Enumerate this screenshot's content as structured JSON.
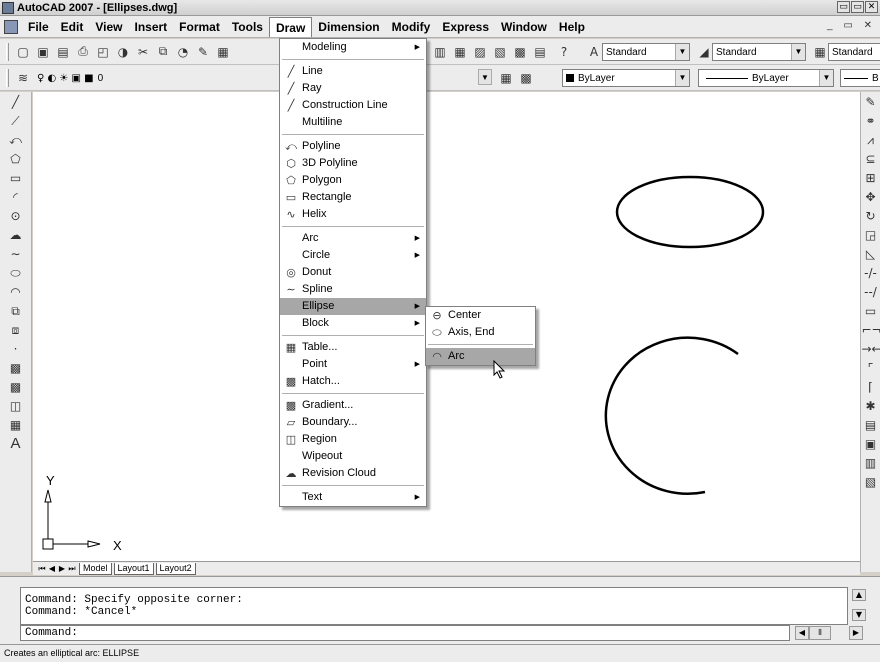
{
  "window": {
    "title": "AutoCAD 2007 - [Ellipses.dwg]",
    "buttons": [
      "▭",
      "▭",
      "✕"
    ]
  },
  "menubar": {
    "items": [
      "File",
      "Edit",
      "View",
      "Insert",
      "Format",
      "Tools",
      "Draw",
      "Dimension",
      "Modify",
      "Express",
      "Window",
      "Help"
    ],
    "active": "Draw",
    "mdi_buttons": "_ ▭ ✕"
  },
  "toolbar": {
    "text_style": "Standard",
    "dim_style": "Standard",
    "table_style": "Standard",
    "layer": "0",
    "color": "ByLayer",
    "linetype": "ByLayer",
    "lineweight": "B"
  },
  "draw_menu": {
    "items": [
      {
        "label": "Modeling",
        "submenu": true,
        "icon": "",
        "underline": "M"
      },
      {
        "sep": true
      },
      {
        "label": "Line",
        "icon": "line-icon",
        "glyph": "╱"
      },
      {
        "label": "Ray",
        "icon": "ray-icon",
        "glyph": "╱"
      },
      {
        "label": "Construction Line",
        "icon": "xline-icon",
        "glyph": "╱"
      },
      {
        "label": "Multiline",
        "icon": ""
      },
      {
        "sep": true
      },
      {
        "label": "Polyline",
        "icon": "polyline-icon",
        "glyph": "⤺"
      },
      {
        "label": "3D Polyline",
        "icon": "3dpolyline-icon",
        "glyph": "⬡"
      },
      {
        "label": "Polygon",
        "icon": "polygon-icon",
        "glyph": "⬠"
      },
      {
        "label": "Rectangle",
        "icon": "rectangle-icon",
        "glyph": "▭"
      },
      {
        "label": "Helix",
        "icon": "helix-icon",
        "glyph": "∿"
      },
      {
        "sep": true
      },
      {
        "label": "Arc",
        "submenu": true,
        "icon": ""
      },
      {
        "label": "Circle",
        "submenu": true,
        "icon": ""
      },
      {
        "label": "Donut",
        "icon": "donut-icon",
        "glyph": "◎"
      },
      {
        "label": "Spline",
        "icon": "spline-icon",
        "glyph": "∼"
      },
      {
        "label": "Ellipse",
        "submenu": true,
        "icon": "",
        "highlight": true
      },
      {
        "label": "Block",
        "submenu": true,
        "icon": ""
      },
      {
        "sep": true
      },
      {
        "label": "Table...",
        "icon": "table-icon",
        "glyph": "▦"
      },
      {
        "label": "Point",
        "submenu": true,
        "icon": ""
      },
      {
        "label": "Hatch...",
        "icon": "hatch-icon",
        "glyph": "▩"
      },
      {
        "sep": true
      },
      {
        "label": "Gradient...",
        "icon": "gradient-icon",
        "glyph": "▩"
      },
      {
        "label": "Boundary...",
        "icon": "boundary-icon",
        "glyph": "▱"
      },
      {
        "label": "Region",
        "icon": "region-icon",
        "glyph": "◫"
      },
      {
        "label": "Wipeout",
        "icon": ""
      },
      {
        "label": "Revision Cloud",
        "icon": "revcloud-icon",
        "glyph": "☁"
      },
      {
        "sep": true
      },
      {
        "label": "Text",
        "submenu": true,
        "icon": ""
      }
    ]
  },
  "ellipse_submenu": {
    "items": [
      {
        "label": "Center",
        "glyph": "⊖"
      },
      {
        "label": "Axis, End",
        "glyph": "⬭"
      },
      {
        "sep": true
      },
      {
        "label": "Arc",
        "glyph": "◠",
        "highlight": true
      }
    ]
  },
  "ucs": {
    "y_label": "Y",
    "x_label": "X"
  },
  "layout_tabs": [
    "Model",
    "Layout1",
    "Layout2"
  ],
  "command": {
    "history": [
      "Command: Specify opposite corner:",
      "Command: *Cancel*"
    ],
    "prompt": "Command:"
  },
  "status": "Creates an elliptical arc: ELLIPSE",
  "colors": {
    "highlight": "#a7a7a7",
    "chrome": "#ececec",
    "canvas": "#ffffff"
  }
}
